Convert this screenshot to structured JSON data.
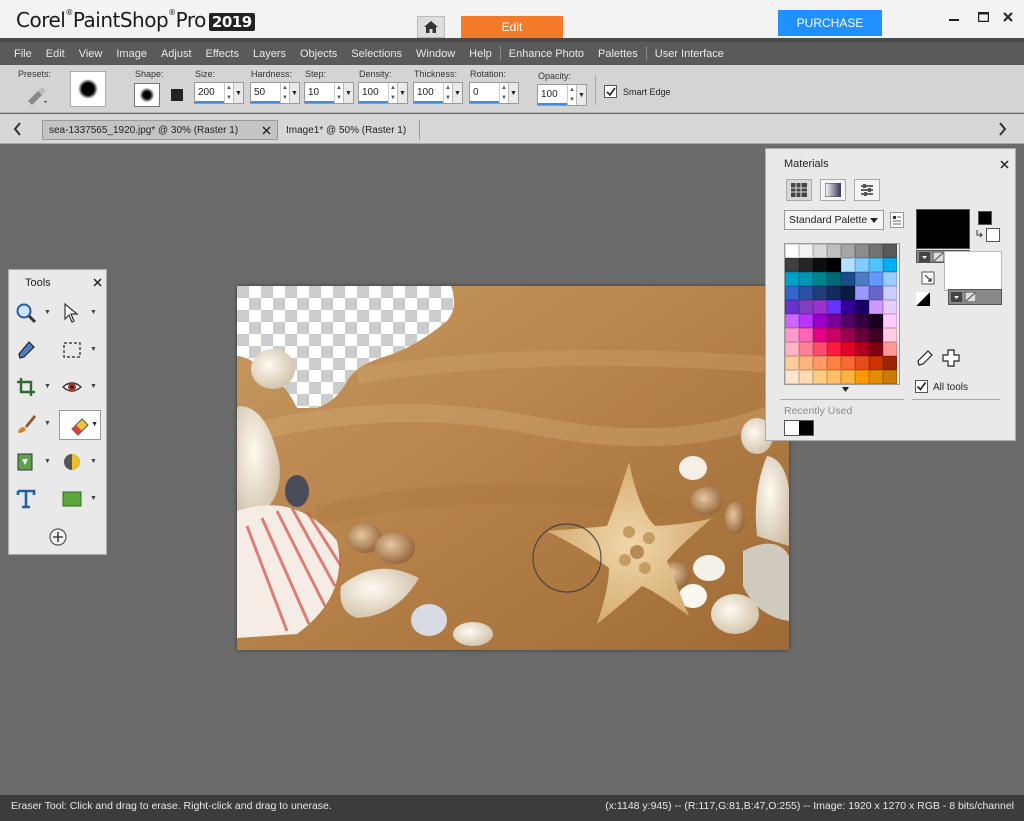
{
  "app": {
    "brand_name": "Corel PaintShop Pro",
    "brand_corel": "Corel",
    "brand_psp": "PaintShop",
    "brand_pro": "Pro",
    "brand_version": "2019",
    "edit_tab": "Edit",
    "purchase": "PURCHASE",
    "accent_color": "#f47b2a",
    "purchase_color": "#1e90ff"
  },
  "menu": [
    "File",
    "Edit",
    "View",
    "Image",
    "Adjust",
    "Effects",
    "Layers",
    "Objects",
    "Selections",
    "Window",
    "Help",
    "Enhance Photo",
    "Palettes",
    "User Interface"
  ],
  "options": {
    "presets_label": "Presets:",
    "shape_label": "Shape:",
    "size_label": "Size:",
    "size_value": "200",
    "hardness_label": "Hardness:",
    "hardness_value": "50",
    "step_label": "Step:",
    "step_value": "10",
    "density_label": "Density:",
    "density_value": "100",
    "thickness_label": "Thickness:",
    "thickness_value": "100",
    "rotation_label": "Rotation:",
    "rotation_value": "0",
    "opacity_label": "Opacity:",
    "opacity_value": "100",
    "smart_edge_label": "Smart Edge",
    "smart_edge_checked": true
  },
  "tabs": [
    {
      "label": "sea-1337565_1920.jpg* @  30% (Raster 1)",
      "active": true
    },
    {
      "label": "Image1* @  50% (Raster 1)",
      "active": false
    }
  ],
  "tools_palette": {
    "title": "Tools",
    "tools": [
      "zoom-icon",
      "pick-icon",
      "dropper-icon",
      "selection-icon",
      "crop-icon",
      "red-eye-icon",
      "paint-brush-icon",
      "eraser-icon",
      "flood-fill-icon",
      "dodge-icon",
      "text-icon",
      "rectangle-shape-icon",
      "add-icon"
    ]
  },
  "materials": {
    "title": "Materials",
    "palette_name": "Standard Palette",
    "recently_used_label": "Recently Used",
    "all_tools_label": "All tools",
    "all_tools_checked": true,
    "foreground_color": "#000000",
    "background_color": "#ffffff",
    "swatches": [
      "#ffffff",
      "#f2f2f2",
      "#d9d9d9",
      "#bfbfbf",
      "#a6a6a6",
      "#8c8c8c",
      "#737373",
      "#595959",
      "#404040",
      "#262626",
      "#0d0d0d",
      "#000000",
      "#b3e0ff",
      "#80ccff",
      "#4dc3ff",
      "#00b0f0",
      "#00a0c6",
      "#0096b4",
      "#00838f",
      "#006874",
      "#1a4b8c",
      "#4d7cc4",
      "#6699ff",
      "#99ccff",
      "#3366cc",
      "#2952a3",
      "#1f3d7a",
      "#14295c",
      "#0a1a40",
      "#9999ff",
      "#6666cc",
      "#ccccff",
      "#6633cc",
      "#8040bf",
      "#9933cc",
      "#6633ff",
      "#330099",
      "#1a0066",
      "#cc99ff",
      "#e6ccff",
      "#cc66ff",
      "#b833ff",
      "#9900cc",
      "#7a0099",
      "#520066",
      "#330040",
      "#1a0020",
      "#ffccff",
      "#ff99cc",
      "#ff66b3",
      "#e6008a",
      "#cc0066",
      "#990052",
      "#66003d",
      "#400026",
      "#ffcce6",
      "#ffb3c6",
      "#ff8099",
      "#ff4d6b",
      "#ff1a40",
      "#e60026",
      "#b3001f",
      "#800016",
      "#ff9999",
      "#ffcc99",
      "#ffb380",
      "#ff9966",
      "#ff8040",
      "#ff6633",
      "#e64d1a",
      "#cc3300",
      "#992600",
      "#ffe5cc",
      "#ffd9b3",
      "#ffcc80",
      "#ffbf66",
      "#ffb340",
      "#ff9900",
      "#e68a00",
      "#cc7a00"
    ],
    "recent_colors": [
      "#ffffff",
      "#000000"
    ]
  },
  "status": {
    "hint": "Eraser Tool: Click and drag to erase. Right-click and drag to unerase.",
    "info": "(x:1148 y:945) -- (R:117,G:81,B:47,O:255) -- Image:  1920 x 1270 x RGB - 8 bits/channel"
  }
}
